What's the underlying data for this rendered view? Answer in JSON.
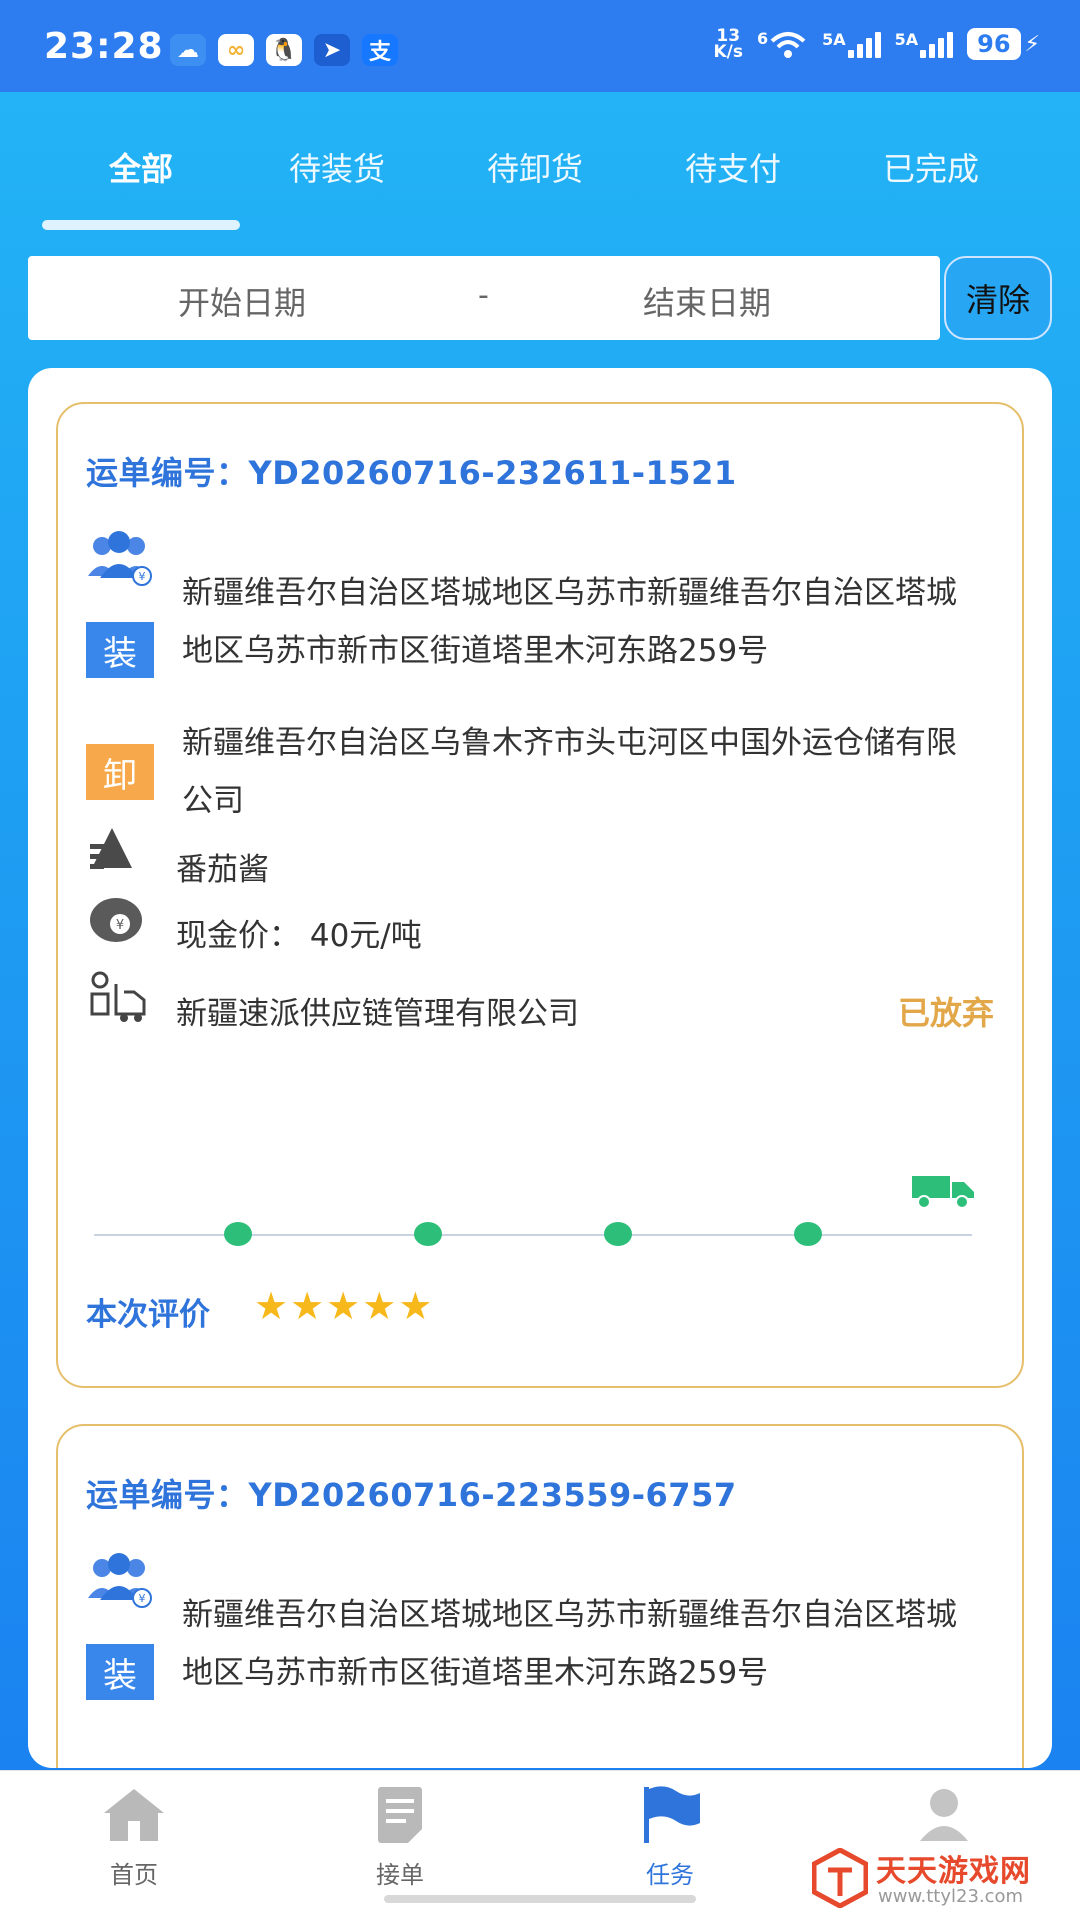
{
  "status_bar": {
    "time": "23:28",
    "net_speed_value": "13",
    "net_speed_unit": "K/s",
    "wifi_label": "6",
    "signal1_label": "5A",
    "signal2_label": "5A",
    "battery": "96"
  },
  "tabs": [
    {
      "label": "全部",
      "active": true
    },
    {
      "label": "待装货"
    },
    {
      "label": "待卸货"
    },
    {
      "label": "待支付"
    },
    {
      "label": "已完成"
    }
  ],
  "date_filter": {
    "start_placeholder": "开始日期",
    "separator": "-",
    "end_placeholder": "结束日期",
    "clear_label": "清除"
  },
  "orders": [
    {
      "waybill_label": "运单编号：",
      "waybill_no": "YD20260716-232611-1521",
      "load_badge": "装",
      "load_address": "新疆维吾尔自治区塔城地区乌苏市新疆维吾尔自治区塔城地区乌苏市新市区街道塔里木河东路259号",
      "unload_badge": "卸",
      "unload_address": "新疆维吾尔自治区乌鲁木齐市头屯河区中国外运仓储有限公司",
      "goods": "番茄酱",
      "price": "现金价：  40元/吨",
      "company": "新疆速派供应链管理有限公司",
      "status": "已放弃",
      "progress_steps": 4,
      "rating_label": "本次评价",
      "rating": 5
    },
    {
      "waybill_label": "运单编号：",
      "waybill_no": "YD20260716-223559-6757",
      "load_badge": "装",
      "load_address": "新疆维吾尔自治区塔城地区乌苏市新疆维吾尔自治区塔城地区乌苏市新市区街道塔里木河东路259号"
    }
  ],
  "bottom_nav": [
    {
      "label": "首页",
      "icon": "home-icon"
    },
    {
      "label": "接单",
      "icon": "document-icon"
    },
    {
      "label": "任务",
      "icon": "flag-icon",
      "active": true
    },
    {
      "label": "",
      "icon": "user-icon"
    }
  ],
  "watermark": {
    "text": "天天游戏网",
    "url": "www.ttyl23.com"
  },
  "colors": {
    "primary_blue": "#2f74db",
    "load_blue": "#3a87ec",
    "unload_orange": "#f6a84b",
    "status_orange": "#e2a748",
    "progress_green": "#2dbf7a",
    "star_yellow": "#f6b81b",
    "card_border": "#e6bf6c"
  }
}
